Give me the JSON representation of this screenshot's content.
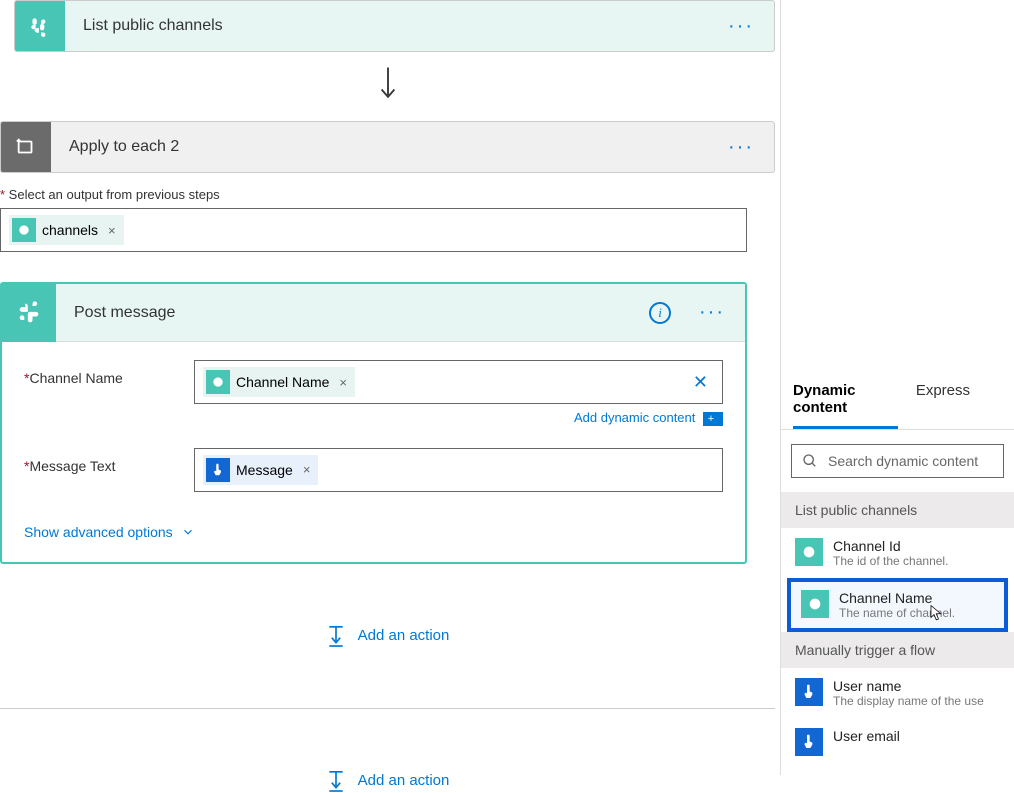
{
  "steps": {
    "list_channels": {
      "title": "List public channels"
    },
    "apply_each": {
      "title": "Apply to each 2",
      "output_label": "Select an output from previous steps",
      "output_token": "channels"
    },
    "post_message": {
      "title": "Post message",
      "fields": {
        "channel_name": {
          "label": "Channel Name",
          "token": "Channel Name"
        },
        "message_text": {
          "label": "Message Text",
          "token": "Message"
        }
      },
      "dynamic_link": "Add dynamic content",
      "advanced": "Show advanced options"
    }
  },
  "add_action": "Add an action",
  "dynamic_panel": {
    "tabs": {
      "dynamic": "Dynamic content",
      "expression": "Express"
    },
    "search_placeholder": "Search dynamic content",
    "groups": [
      {
        "title": "List public channels",
        "items": [
          {
            "name": "Channel Id",
            "desc": "The id of the channel."
          },
          {
            "name": "Channel Name",
            "desc": "The name of channel."
          }
        ]
      },
      {
        "title": "Manually trigger a flow",
        "items": [
          {
            "name": "User name",
            "desc": "The display name of the use"
          },
          {
            "name": "User email",
            "desc": ""
          }
        ]
      }
    ]
  }
}
